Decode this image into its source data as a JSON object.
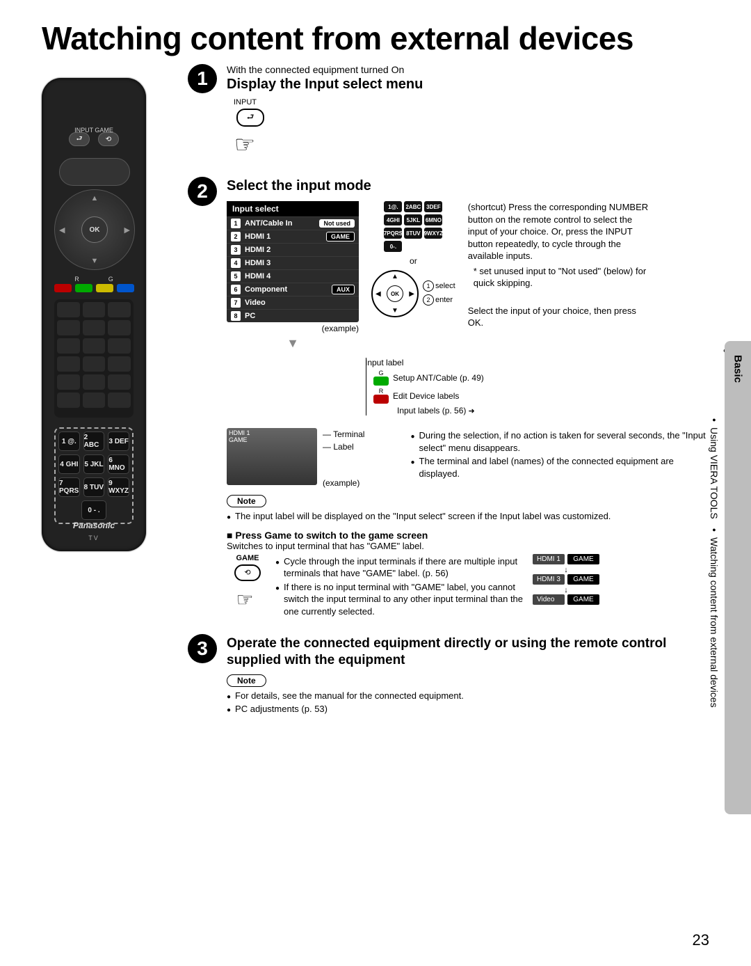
{
  "page_number": "23",
  "title": "Watching content from external devices",
  "side_tab": "Basic",
  "side_lines": [
    "Watching content from external devices",
    "Using VIERA TOOLS"
  ],
  "remote": {
    "top_labels": "INPUT GAME",
    "ok_label": "OK",
    "rg_left": "R",
    "rg_right": "G",
    "numpad": [
      [
        "1 @.",
        "2 ABC",
        "3 DEF"
      ],
      [
        "4 GHI",
        "5 JKL",
        "6 MNO"
      ],
      [
        "7 PQRS",
        "8 TUV",
        "9 WXYZ"
      ]
    ],
    "numpad_zero": "0 - .",
    "brand": "Panasonic",
    "tv": "TV"
  },
  "step1": {
    "intro": "With the connected equipment turned On",
    "title": "Display the Input select menu",
    "input_label": "INPUT"
  },
  "step2": {
    "title": "Select the input mode",
    "menu_title": "Input select",
    "menu_rows": [
      {
        "n": "1",
        "label": "ANT/Cable In",
        "tag": "Not used",
        "tagStyle": "plain"
      },
      {
        "n": "2",
        "label": "HDMI 1",
        "tag": "GAME",
        "tagStyle": "inv"
      },
      {
        "n": "3",
        "label": "HDMI 2",
        "tag": "",
        "tagStyle": ""
      },
      {
        "n": "4",
        "label": "HDMI 3",
        "tag": "",
        "tagStyle": ""
      },
      {
        "n": "5",
        "label": "HDMI 4",
        "tag": "",
        "tagStyle": ""
      },
      {
        "n": "6",
        "label": "Component",
        "tag": "AUX",
        "tagStyle": "inv"
      },
      {
        "n": "7",
        "label": "Video",
        "tag": "",
        "tagStyle": ""
      },
      {
        "n": "8",
        "label": "PC",
        "tag": "",
        "tagStyle": ""
      }
    ],
    "example_label": "(example)",
    "mini_keys": [
      "1@.",
      "2ABC",
      "3DEF",
      "4GHI",
      "5JKL",
      "6MNO",
      "7PQRS",
      "8TUV",
      "9WXYZ"
    ],
    "mini_zero": "0-.",
    "or": "or",
    "ok": "OK",
    "select_label": "select",
    "enter_label": "enter",
    "shortcut_text": "(shortcut) Press the corresponding NUMBER button on the remote control to select the input of your choice. Or, press the INPUT button repeatedly, to cycle through the available inputs.",
    "footnote": "* set unused input to \"Not used\" (below) for quick skipping.",
    "select_ok_text": "Select the input of your choice, then press OK.",
    "input_label_header": "Input label",
    "green_letter": "G",
    "red_letter": "R",
    "green_line": "Setup ANT/Cable (p. 49)",
    "red_line": "Edit Device labels",
    "red_sub": "Input labels (p. 56)",
    "terminal_label": "Terminal",
    "label_label": "Label",
    "preview_line1": "HDMI 1",
    "preview_line2": "GAME",
    "preview_example": "(example)",
    "bullets_a": "During the selection, if no action is taken for several seconds, the \"Input select\" menu disappears.",
    "bullets_b": "The terminal and label (names) of the connected equipment are displayed.",
    "note_label": "Note",
    "note_text": "The input label will be displayed on the \"Input select\" screen if the Input label was customized.",
    "game_heading": "Press Game to switch to the game screen",
    "game_intro": "Switches to input terminal that has \"GAME\" label.",
    "game_btn_label": "GAME",
    "game_bullet1": "Cycle through the input terminals if there are multiple input terminals that have \"GAME\" label. (p. 56)",
    "game_bullet2": "If there is no input terminal with \"GAME\" label, you cannot switch the input terminal to any other input terminal than the one currently selected.",
    "cycle": [
      {
        "l": "HDMI 1",
        "r": "GAME"
      },
      {
        "l": "HDMI 3",
        "r": "GAME"
      },
      {
        "l": "Video",
        "r": "GAME"
      }
    ]
  },
  "step3": {
    "title": "Operate the connected equipment directly or using the remote control supplied with the equipment",
    "note_label": "Note",
    "bullet1": "For details, see the manual for the connected equipment.",
    "bullet2": "PC adjustments (p. 53)"
  }
}
